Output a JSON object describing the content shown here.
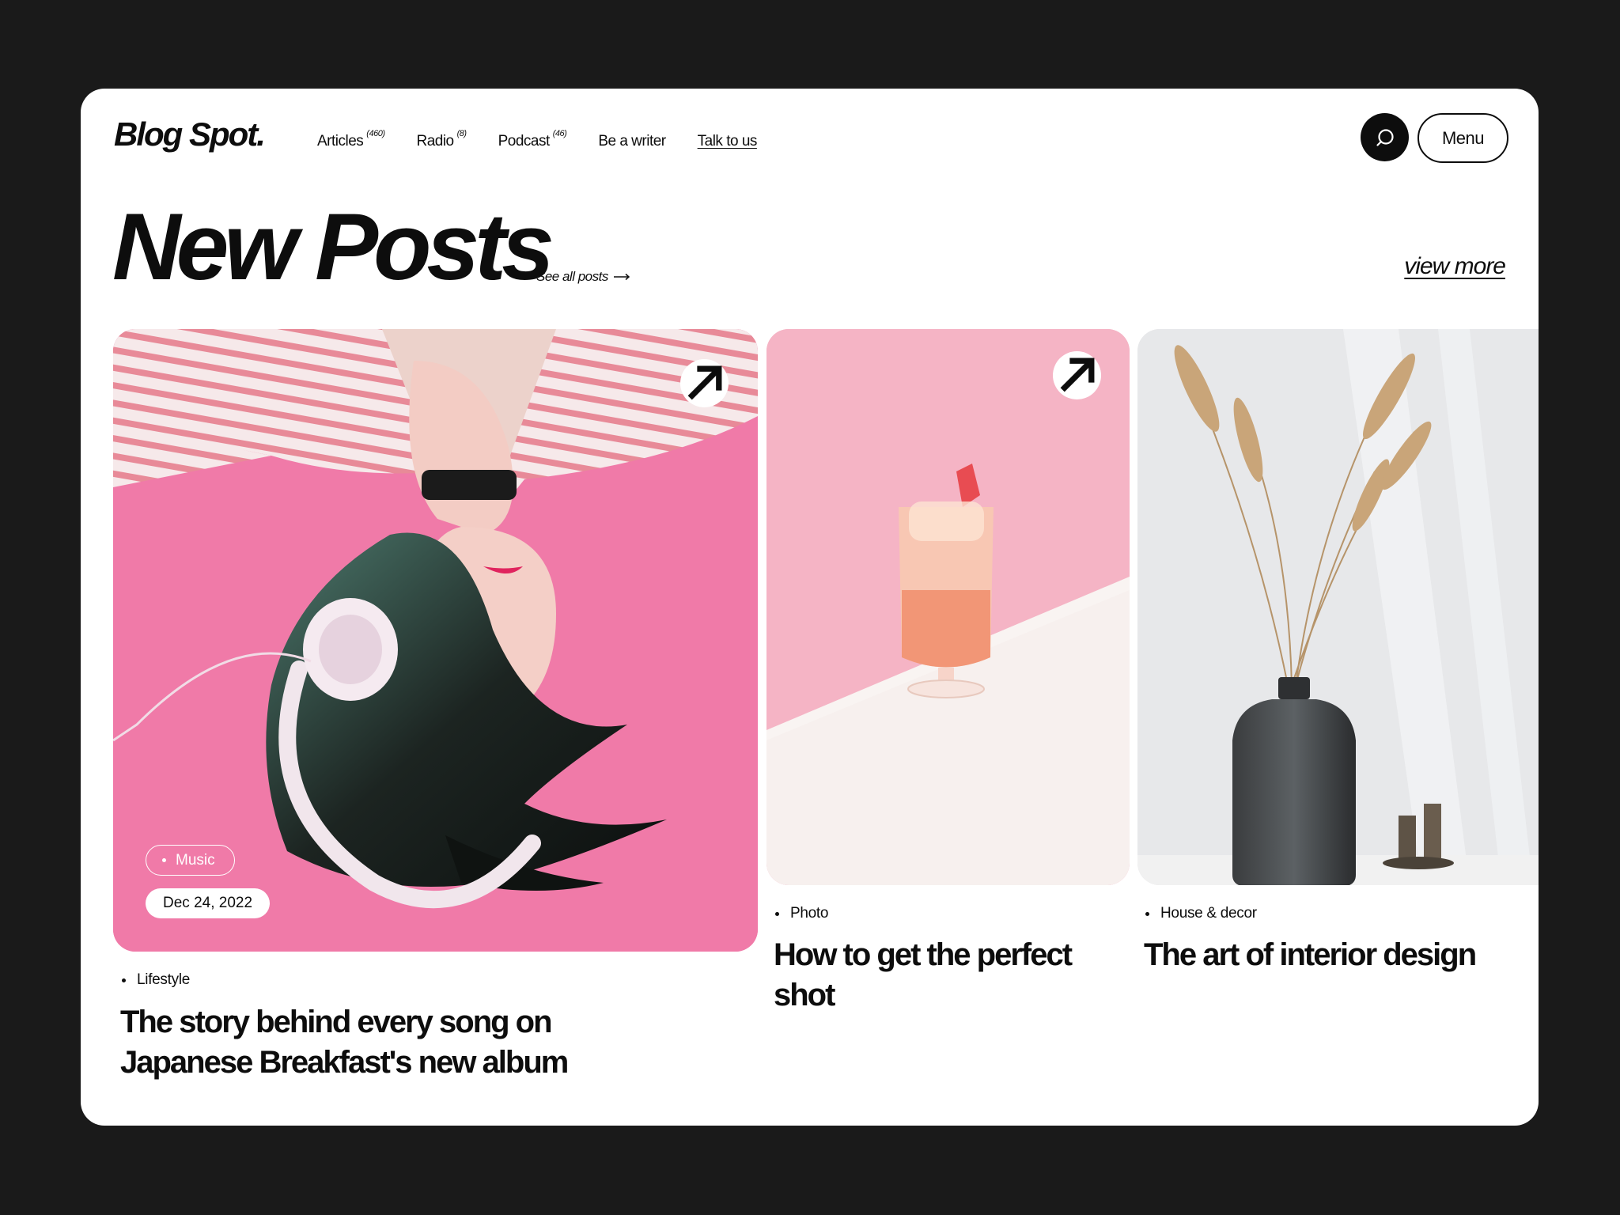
{
  "header": {
    "logo": "Blog Spot.",
    "nav": [
      {
        "label": "Articles",
        "count": "(460)"
      },
      {
        "label": "Radio",
        "count": "(8)"
      },
      {
        "label": "Podcast",
        "count": "(46)"
      },
      {
        "label": "Be a writer",
        "count": ""
      },
      {
        "label": "Talk to us",
        "count": ""
      }
    ],
    "search_icon": "search-icon",
    "menu_label": "Menu"
  },
  "section": {
    "title": "New Posts",
    "see_all": "See all posts",
    "view_more": "view more"
  },
  "posts": [
    {
      "tag": "Music",
      "date": "Dec 24, 2022",
      "category": "Lifestyle",
      "title_line1": "The story behind every song on",
      "title_line2": "Japanese Breakfast's new album",
      "image": "girl-with-headphones-photo"
    },
    {
      "category": "Photo",
      "title_line1": "How to get the perfect",
      "title_line2": "shot",
      "image": "cocktail-glass-photo"
    },
    {
      "category": "House & decor",
      "title_line1": "The art of interior design",
      "image": "vase-with-dried-grass-photo"
    }
  ],
  "colors": {
    "background": "#1a1a1a",
    "surface": "#ffffff",
    "text": "#0d0d0d",
    "pink": "#f07aa8"
  }
}
